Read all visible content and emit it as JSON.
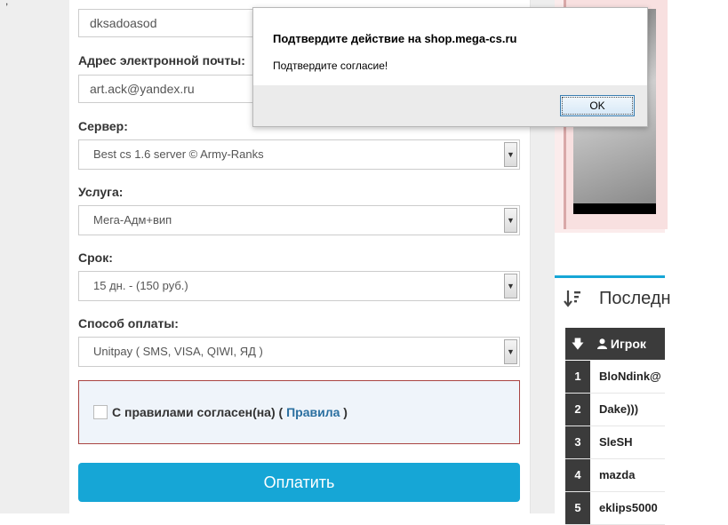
{
  "form": {
    "name_value": "dksadoasod",
    "email_label": "Адрес электронной почты:",
    "email_value": "art.ack@yandex.ru",
    "server_label": "Сервер:",
    "server_value": "Best cs 1.6 server © Army-Ranks",
    "service_label": "Услуга:",
    "service_value": "Мега-Адм+вип",
    "term_label": "Срок:",
    "term_value": "15 дн. - (150 руб.)",
    "payment_label": "Способ оплаты:",
    "payment_value": "Unitpay ( SMS, VISA, QIWI, ЯД )",
    "agree_text": "С правилами согласен(на) (",
    "agree_link": "Правила",
    "agree_close": ")",
    "pay_button": "Оплатить"
  },
  "dialog": {
    "title": "Подтвердите действие на shop.mega-cs.ru",
    "message": "Подтвердите согласие!",
    "ok_label": "OK"
  },
  "last_players": {
    "title": "Последн",
    "column_player": "Игрок",
    "rows": [
      {
        "rank": "1",
        "name": "BloNdink@"
      },
      {
        "rank": "2",
        "name": "Dake)))"
      },
      {
        "rank": "3",
        "name": "SleSH"
      },
      {
        "rank": "4",
        "name": "mazda"
      },
      {
        "rank": "5",
        "name": "eklips5000"
      }
    ]
  },
  "colors": {
    "accent": "#16a6d6",
    "error_border": "#a94442",
    "table_header": "#3b3b3b"
  }
}
